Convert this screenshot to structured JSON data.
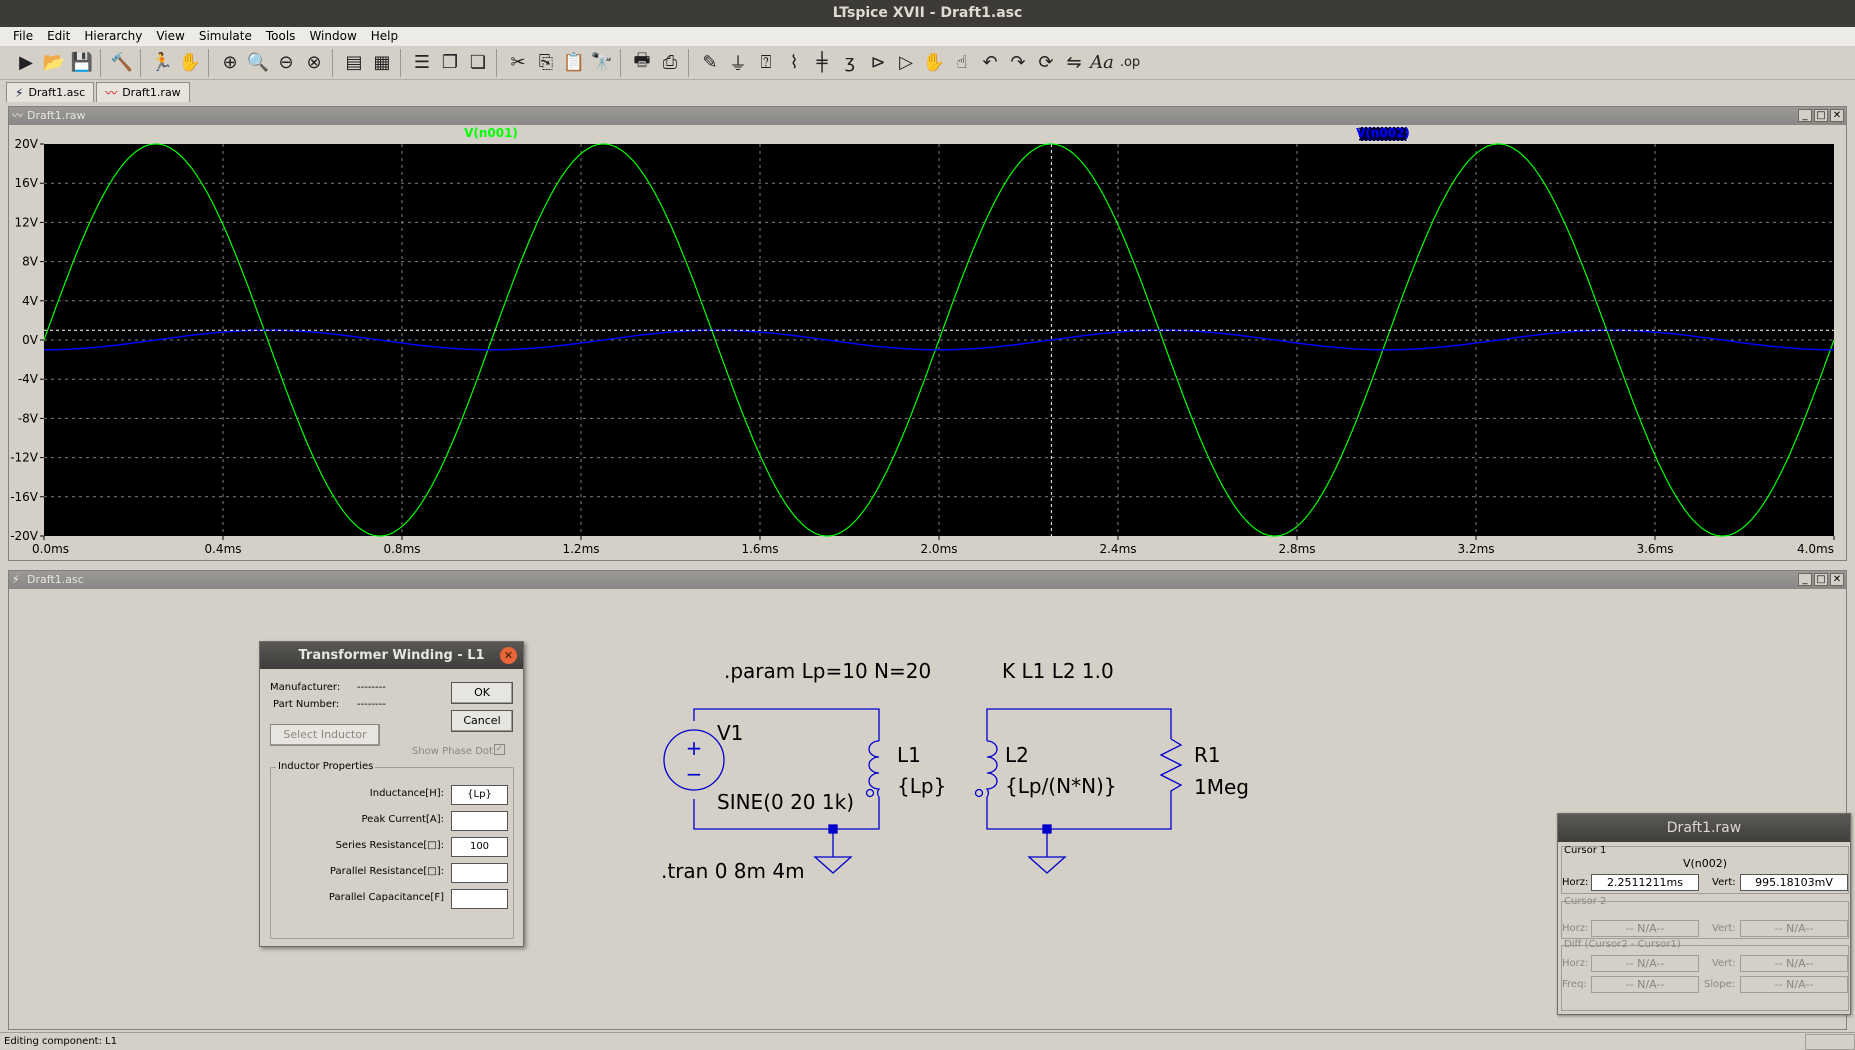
{
  "window_title": "LTspice XVII - Draft1.asc",
  "menu": [
    "File",
    "Edit",
    "Hierarchy",
    "View",
    "Simulate",
    "Tools",
    "Window",
    "Help"
  ],
  "toolbar_icons": [
    "run-icon",
    "open-icon",
    "save-icon",
    "control-panel-icon",
    "halt-icon",
    "pan-icon",
    "zoom-in-icon",
    "zoom-area-icon",
    "zoom-out-icon",
    "zoom-fit-icon",
    "autorange-icon",
    "grid-icon",
    "tile-horizontal-icon",
    "tile-vertical-icon",
    "cascade-icon",
    "cut-icon",
    "copy-icon",
    "paste-icon",
    "find-icon",
    "print-preview-icon",
    "print-icon",
    "draw-wire-icon",
    "ground-icon",
    "label-net-icon",
    "resistor-icon",
    "capacitor-icon",
    "inductor-icon",
    "diode-icon",
    "component-icon",
    "move-icon",
    "drag-icon",
    "undo-icon",
    "redo-icon",
    "rotate-icon",
    "mirror-icon",
    "text-icon",
    "spice-directive-icon"
  ],
  "tabs": [
    {
      "label": "Draft1.asc",
      "icon": "schematic-icon"
    },
    {
      "label": "Draft1.raw",
      "icon": "waveform-icon"
    }
  ],
  "waveform_window": {
    "title": "Draft1.raw",
    "traces": [
      {
        "label": "V(n001)",
        "color": "#00ff00"
      },
      {
        "label": "V(n002)",
        "color": "#0000ff"
      }
    ],
    "cursor_time_ms": 2.2511211,
    "cursor_level_v": 0.995
  },
  "chart_data": {
    "type": "line",
    "xlabel": "",
    "ylabel": "",
    "x_range_ms": [
      0,
      4
    ],
    "y_range_v": [
      -20,
      20
    ],
    "x_ticks": [
      "0.0ms",
      "0.4ms",
      "0.8ms",
      "1.2ms",
      "1.6ms",
      "2.0ms",
      "2.4ms",
      "2.8ms",
      "3.2ms",
      "3.6ms",
      "4.0ms"
    ],
    "y_ticks": [
      "20V",
      "16V",
      "12V",
      "8V",
      "4V",
      "0V",
      "-4V",
      "-8V",
      "-12V",
      "-16V",
      "-20V"
    ],
    "grid": true,
    "series": [
      {
        "name": "V(n001)",
        "amplitude_v": 20,
        "frequency_hz": 1000,
        "phase_deg": 0
      },
      {
        "name": "V(n002)",
        "amplitude_v": 1,
        "frequency_hz": 1000,
        "phase_deg": -90
      }
    ]
  },
  "schematic_window": {
    "title": "Draft1.asc",
    "directives": {
      "param": ".param Lp=10 N=20",
      "coupling": "K L1 L2 1.0",
      "tran": ".tran 0 8m 4m"
    },
    "components": {
      "v1_name": "V1",
      "v1_value": "SINE(0 20 1k)",
      "l1_name": "L1",
      "l1_value": "{Lp}",
      "l2_name": "L2",
      "l2_value": "{Lp/(N*N)}",
      "r1_name": "R1",
      "r1_value": "1Meg"
    }
  },
  "dialog": {
    "title": "Transformer Winding - L1",
    "manufacturer_label": "Manufacturer:",
    "manufacturer_value": "--------",
    "part_number_label": "Part Number:",
    "part_number_value": "--------",
    "ok_label": "OK",
    "cancel_label": "Cancel",
    "select_inductor_label": "Select Inductor",
    "show_phase_dot_label": "Show Phase Dot",
    "group_label": "Inductor Properties",
    "fields": [
      {
        "label": "Inductance[H]:",
        "value": "{Lp}"
      },
      {
        "label": "Peak Current[A]:",
        "value": ""
      },
      {
        "label": "Series Resistance[□]:",
        "value": "100"
      },
      {
        "label": "Parallel Resistance[□]:",
        "value": ""
      },
      {
        "label": "Parallel Capacitance[F]",
        "value": ""
      }
    ]
  },
  "cursor_window": {
    "title": "Draft1.raw",
    "cursor1_label": "Cursor 1",
    "cursor1_trace": "V(n002)",
    "horz_label": "Horz:",
    "vert_label": "Vert:",
    "cursor1_horz": "2.2511211ms",
    "cursor1_vert": "995.18103mV",
    "cursor2_label": "Cursor 2",
    "na": "-- N/A--",
    "diff_label": "Diff (Cursor2 - Cursor1)",
    "freq_label": "Freq:",
    "slope_label": "Slope:"
  },
  "status_text": "Editing component: L1"
}
